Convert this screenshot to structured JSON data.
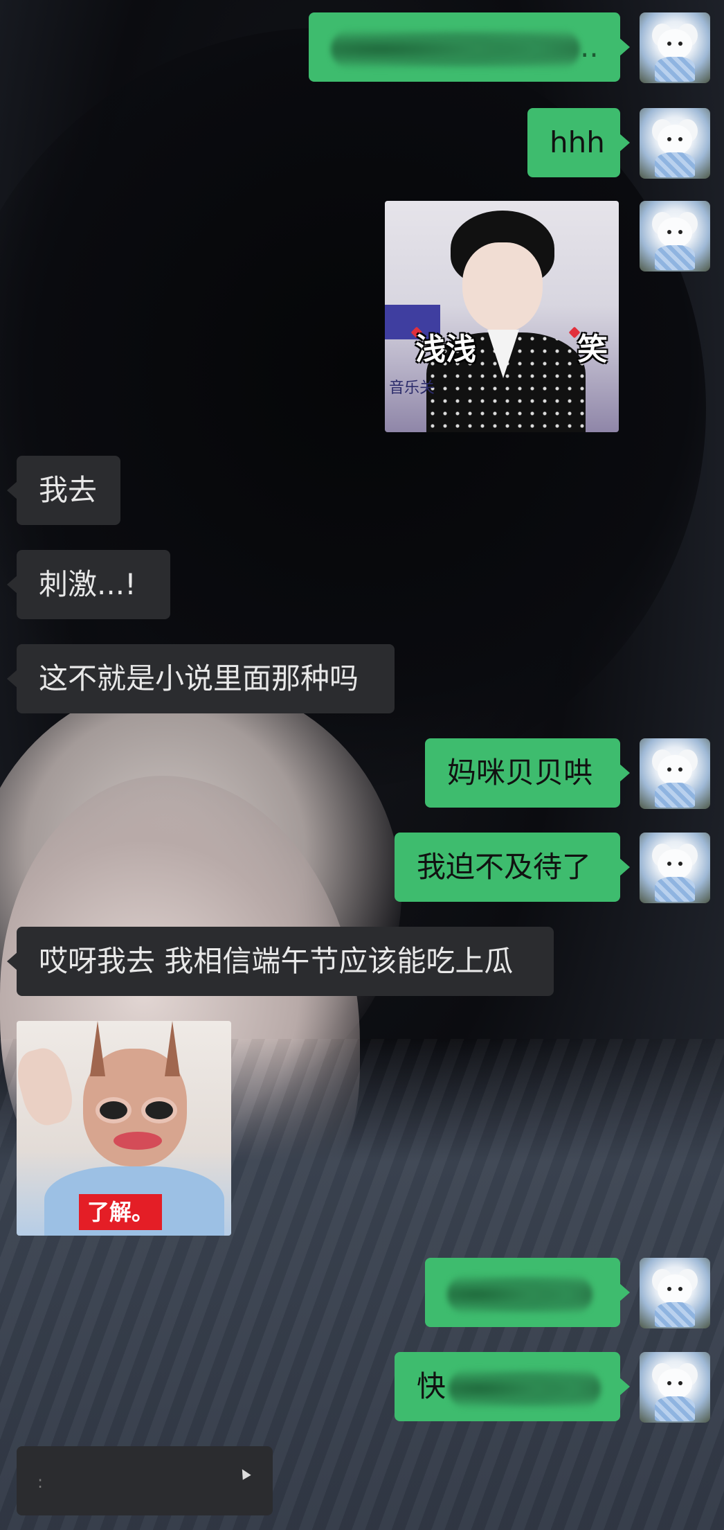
{
  "messages": [
    {
      "side": "out",
      "kind": "redacted",
      "text": ".."
    },
    {
      "side": "out",
      "kind": "text",
      "text": "hhh"
    },
    {
      "side": "out",
      "kind": "sticker",
      "caption_left": "浅浅",
      "caption_right": "笑",
      "sub": "音乐关"
    },
    {
      "side": "in",
      "kind": "text",
      "text": "我去"
    },
    {
      "side": "in",
      "kind": "text",
      "text": "刺激...!"
    },
    {
      "side": "in",
      "kind": "text",
      "text": "这不就是小说里面那种吗"
    },
    {
      "side": "out",
      "kind": "text",
      "text": "妈咪贝贝哄"
    },
    {
      "side": "out",
      "kind": "text",
      "text": "我迫不及待了"
    },
    {
      "side": "in",
      "kind": "text",
      "text": "哎呀我去 我相信端午节应该能吃上瓜"
    },
    {
      "side": "in",
      "kind": "sticker",
      "label": "了解。"
    },
    {
      "side": "out",
      "kind": "redacted",
      "text": ""
    },
    {
      "side": "out",
      "kind": "text",
      "text": "快"
    },
    {
      "side": "in",
      "kind": "partial",
      "text": ""
    }
  ],
  "colors": {
    "outgoing_bubble": "#3ebc6e",
    "incoming_bubble": "#2b2c2f",
    "incoming_text": "#e8e8e8",
    "outgoing_text": "#111111"
  },
  "avatar_icon": "plush-dog-avatar"
}
